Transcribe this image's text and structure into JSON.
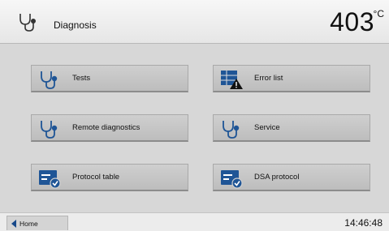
{
  "header": {
    "title": "Diagnosis",
    "temperature": "403",
    "unit": "°C",
    "icon": "stethoscope-icon"
  },
  "tiles": [
    {
      "label": "Tests",
      "icon": "stethoscope-icon"
    },
    {
      "label": "Error list",
      "icon": "error-list-warning-icon"
    },
    {
      "label": "Remote diagnostics",
      "icon": "stethoscope-icon"
    },
    {
      "label": "Service",
      "icon": "stethoscope-icon"
    },
    {
      "label": "Protocol table",
      "icon": "protocol-check-icon"
    },
    {
      "label": "DSA protocol",
      "icon": "protocol-check-icon"
    }
  ],
  "footer": {
    "home_label": "Home",
    "clock": "14:46:48"
  },
  "colors": {
    "accent": "#1f5596",
    "warning": "#111111"
  }
}
